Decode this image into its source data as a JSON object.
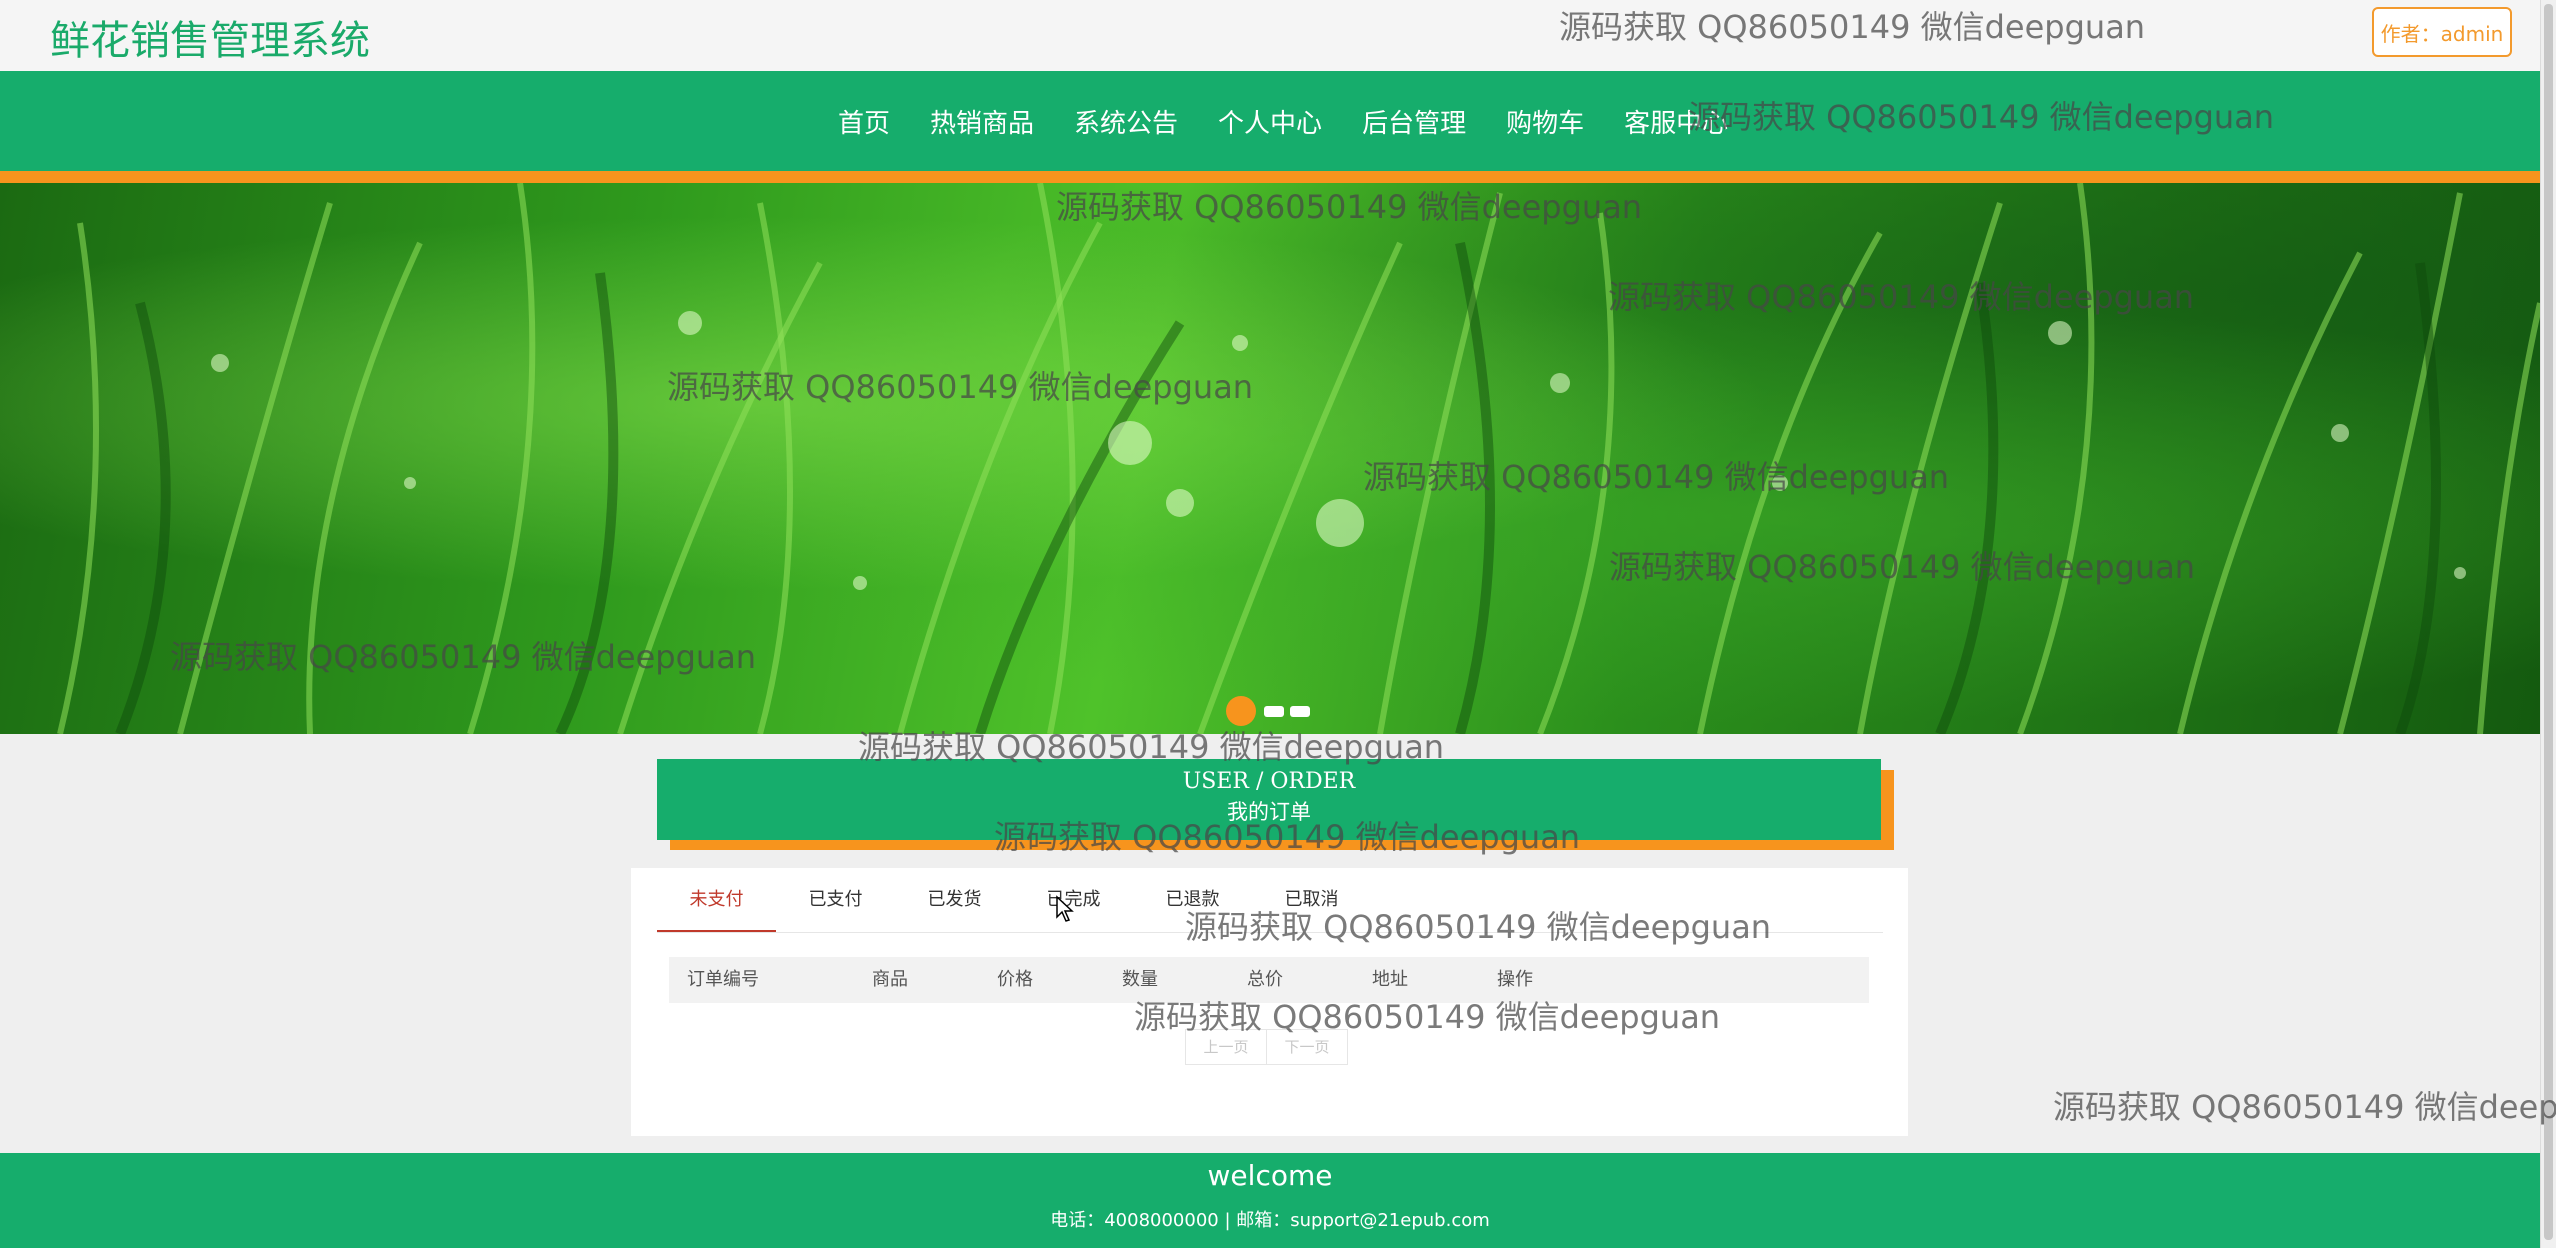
{
  "header": {
    "site_title": "鲜花销售管理系统",
    "author_label": "作者：admin"
  },
  "nav": {
    "items": [
      "首页",
      "热销商品",
      "系统公告",
      "个人中心",
      "后台管理",
      "购物车",
      "客服中心"
    ]
  },
  "banner": {
    "carousel_page": 1,
    "carousel_total": 3
  },
  "order_section": {
    "title_en": "USER / ORDER",
    "title_cn": "我的订单"
  },
  "order_tabs": {
    "active": "未支付",
    "items": [
      "未支付",
      "已支付",
      "已发货",
      "已完成",
      "已退款",
      "已取消"
    ]
  },
  "order_table": {
    "columns": [
      "订单编号",
      "商品",
      "价格",
      "数量",
      "总价",
      "地址",
      "操作"
    ],
    "rows": []
  },
  "pager": {
    "prev": "上一页",
    "next": "下一页"
  },
  "footer": {
    "welcome": "welcome",
    "contact": "电话：4008000000 | 邮箱：support@21epub.com"
  },
  "watermark_text": "源码获取 QQ86050149 微信deepguan",
  "colors": {
    "primary_green": "#16ad6c",
    "accent_orange": "#f7941d",
    "active_tab_red": "#c0392b"
  }
}
